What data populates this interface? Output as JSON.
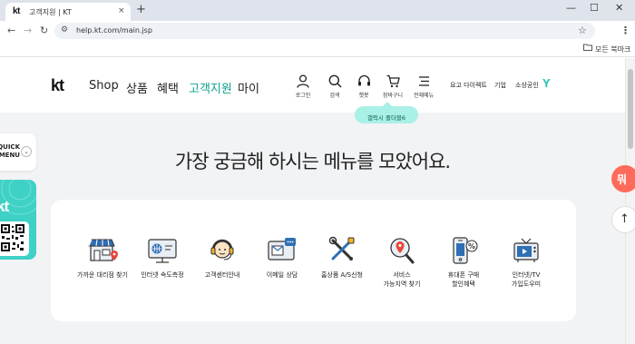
{
  "browser": {
    "tab_favicon": "kt",
    "tab_title": "고객지원 | KT",
    "tab_close": "×",
    "new_tab": "+",
    "minimize": "—",
    "maximize": "☐",
    "close": "✕",
    "back": "←",
    "forward": "→",
    "reload": "↻",
    "site_info_icon": "⚙",
    "url": "help.kt.com/main.jsp",
    "star": "☆",
    "menu": "⋮",
    "bookmarks_label": "모든 북마크"
  },
  "header": {
    "logo": "kt",
    "nav": [
      {
        "label": "Shop"
      },
      {
        "label": "상품"
      },
      {
        "label": "혜택"
      },
      {
        "label": "고객지원",
        "active": true
      },
      {
        "label": "마이"
      }
    ],
    "utilities": [
      {
        "label": "로그인",
        "icon": "user-icon"
      },
      {
        "label": "검색",
        "icon": "search-icon"
      },
      {
        "label": "챗봇",
        "icon": "headset-icon"
      },
      {
        "label": "장바구니",
        "icon": "cart-icon"
      },
      {
        "label": "전체메뉴",
        "icon": "menu-icon"
      }
    ],
    "right_links": [
      "요고 다이렉트",
      "기업",
      "소상공인"
    ],
    "y_logo": "Y",
    "tooltip": "갤럭시 폴더블6"
  },
  "quick_menu": {
    "line1": "QUICK",
    "line2": "MENU",
    "chevron": "⌄"
  },
  "qr_banner": {
    "logo": "kt"
  },
  "hero": {
    "title": "가장 궁금해 하시는 메뉴를 모았어요."
  },
  "menu_items": [
    {
      "label_1": "가까운 대리점 찾기",
      "label_2": "",
      "icon": "store-icon"
    },
    {
      "label_1": "인터넷 속도측정",
      "label_2": "",
      "icon": "speed-test-icon"
    },
    {
      "label_1": "고객센터안내",
      "label_2": "",
      "icon": "customer-center-icon"
    },
    {
      "label_1": "이메일 상담",
      "label_2": "",
      "icon": "email-icon"
    },
    {
      "label_1": "홈상품 A/S신청",
      "label_2": "",
      "icon": "tools-icon"
    },
    {
      "label_1": "서비스",
      "label_2": "가능지역 찾기",
      "icon": "map-search-icon"
    },
    {
      "label_1": "휴대폰 구매",
      "label_2": "할인혜택",
      "icon": "phone-discount-icon"
    },
    {
      "label_1": "인터넷/TV",
      "label_2": "가입도우미",
      "icon": "tv-icon"
    }
  ],
  "floating": {
    "red_button": "뭐",
    "up_button": "↑"
  },
  "colors": {
    "accent": "#0d9f8f",
    "mint": "#3fd1c5",
    "tooltip": "#a9f0e6",
    "fab": "#ff6b5a"
  }
}
